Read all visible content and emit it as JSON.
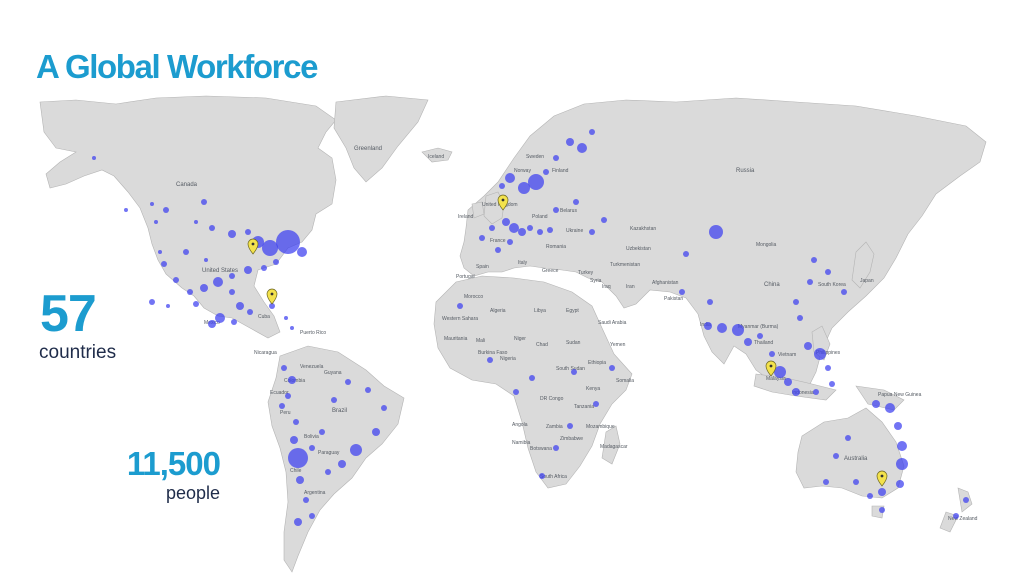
{
  "slide": {
    "title": "A Global Workforce",
    "accent_color": "#1c9ccf",
    "dot_color": "#3b3ff0",
    "marker_color": "#f3e24c"
  },
  "stats": {
    "countries_value": "57",
    "countries_label": "countries",
    "people_value": "11,500",
    "people_label": "people"
  },
  "map_labels": {
    "greenland": "Greenland",
    "iceland": "Iceland",
    "canada": "Canada",
    "united_states": "United States",
    "mexico": "Mexico",
    "cuba": "Cuba",
    "puerto_rico": "Puerto Rico",
    "nicaragua": "Nicaragua",
    "venezuela": "Venezuela",
    "colombia": "Colombia",
    "guyana": "Guyana",
    "ecuador": "Ecuador",
    "peru": "Peru",
    "brazil": "Brazil",
    "bolivia": "Bolivia",
    "paraguay": "Paraguay",
    "chile": "Chile",
    "argentina": "Argentina",
    "uk": "United Kingdom",
    "ireland": "Ireland",
    "france": "France",
    "spain": "Spain",
    "portugal": "Portugal",
    "italy": "Italy",
    "poland": "Poland",
    "belarus": "Belarus",
    "ukraine": "Ukraine",
    "romania": "Romania",
    "greece": "Greece",
    "turkey": "Turkey",
    "norway": "Norway",
    "sweden": "Sweden",
    "finland": "Finland",
    "russia": "Russia",
    "kazakhstan": "Kazakhstan",
    "mongolia": "Mongolia",
    "uzbekistan": "Uzbekistan",
    "turkmenistan": "Turkmenistan",
    "afghanistan": "Afghanistan",
    "pakistan": "Pakistan",
    "iran": "Iran",
    "iraq": "Iraq",
    "syria": "Syria",
    "china": "China",
    "south_korea": "South Korea",
    "japan": "Japan",
    "india": "India",
    "myanmar": "Myanmar (Burma)",
    "thailand": "Thailand",
    "vietnam": "Vietnam",
    "philippines": "Philippines",
    "malaysia": "Malaysia",
    "indonesia": "Indonesia",
    "papua": "Papua New Guinea",
    "australia": "Australia",
    "new_zealand": "New Zealand",
    "morocco": "Morocco",
    "algeria": "Algeria",
    "libya": "Libya",
    "egypt": "Egypt",
    "western_sahara": "Western Sahara",
    "mauritania": "Mauritania",
    "mali": "Mali",
    "niger": "Niger",
    "chad": "Chad",
    "sudan": "Sudan",
    "south_sudan": "South Sudan",
    "ethiopia": "Ethiopia",
    "somalia": "Somalia",
    "kenya": "Kenya",
    "tanzania": "Tanzania",
    "dr_congo": "DR Congo",
    "angola": "Angola",
    "zambia": "Zambia",
    "zimbabwe": "Zimbabwe",
    "mozambique": "Mozambique",
    "namibia": "Namibia",
    "botswana": "Botswana",
    "south_africa": "South Africa",
    "madagascar": "Madagascar",
    "saudi_arabia": "Saudi Arabia",
    "yemen": "Yemen",
    "burkina_faso": "Burkina Faso",
    "nigeria": "Nigeria"
  }
}
